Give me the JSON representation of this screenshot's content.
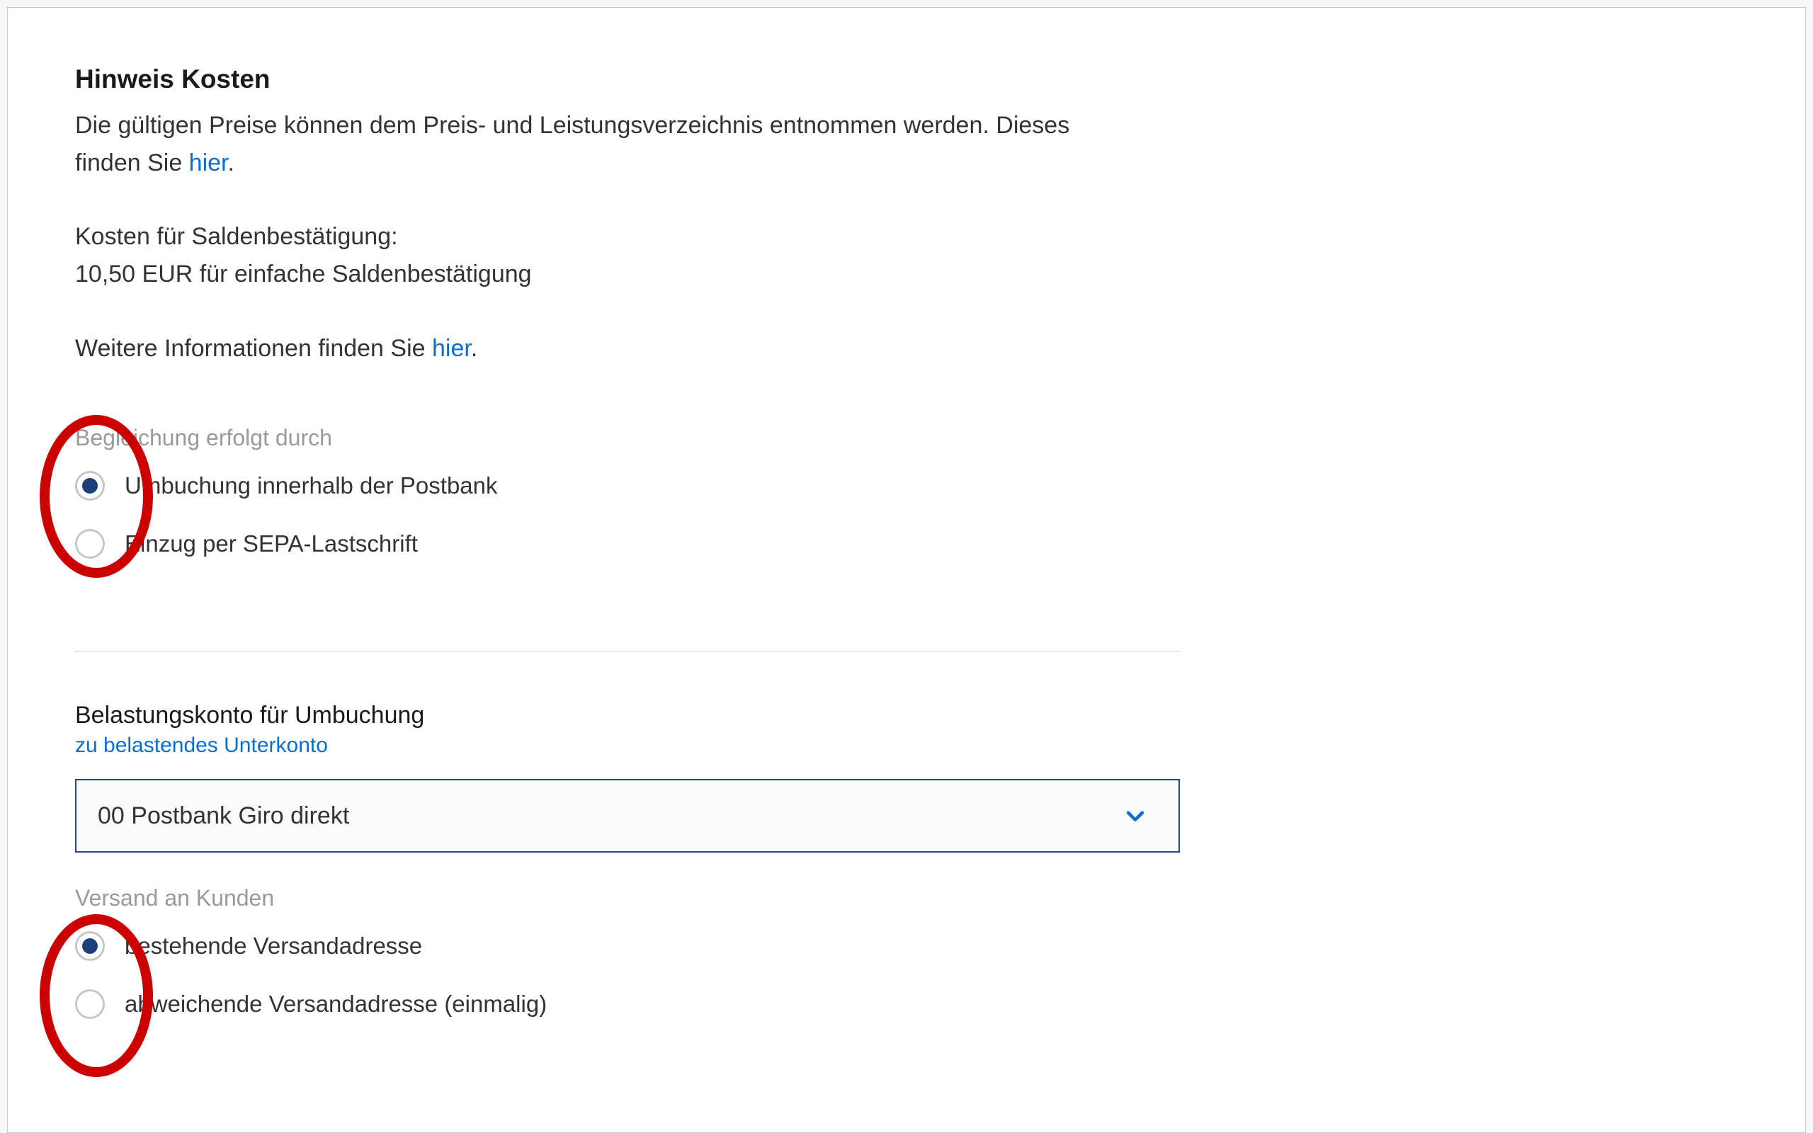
{
  "heading": "Hinweis Kosten",
  "intro_line1": "Die gültigen Preise können dem Preis- und Leistungsverzeichnis entnommen werden. Dieses",
  "intro_line2_pre": "finden Sie ",
  "intro_link1": "hier",
  "intro_line2_post": ".",
  "cost_line1": "Kosten für Saldenbestätigung:",
  "cost_line2": "10,50 EUR für einfache Saldenbestätigung",
  "more_info_pre": "Weitere Informationen finden Sie ",
  "more_info_link": "hier",
  "more_info_post": ".",
  "settlement_label": "Begleichung erfolgt durch",
  "settlement_opt1": "Umbuchung innerhalb der Postbank",
  "settlement_opt2": "Einzug per SEPA-Lastschrift",
  "debit_account_heading": "Belastungskonto für Umbuchung",
  "debit_account_sublabel": "zu belastendes Unterkonto",
  "debit_account_value": "00 Postbank Giro direkt",
  "shipping_label": "Versand an Kunden",
  "shipping_opt1": "bestehende Versandadresse",
  "shipping_opt2": "abweichende Versandadresse (einmalig)"
}
